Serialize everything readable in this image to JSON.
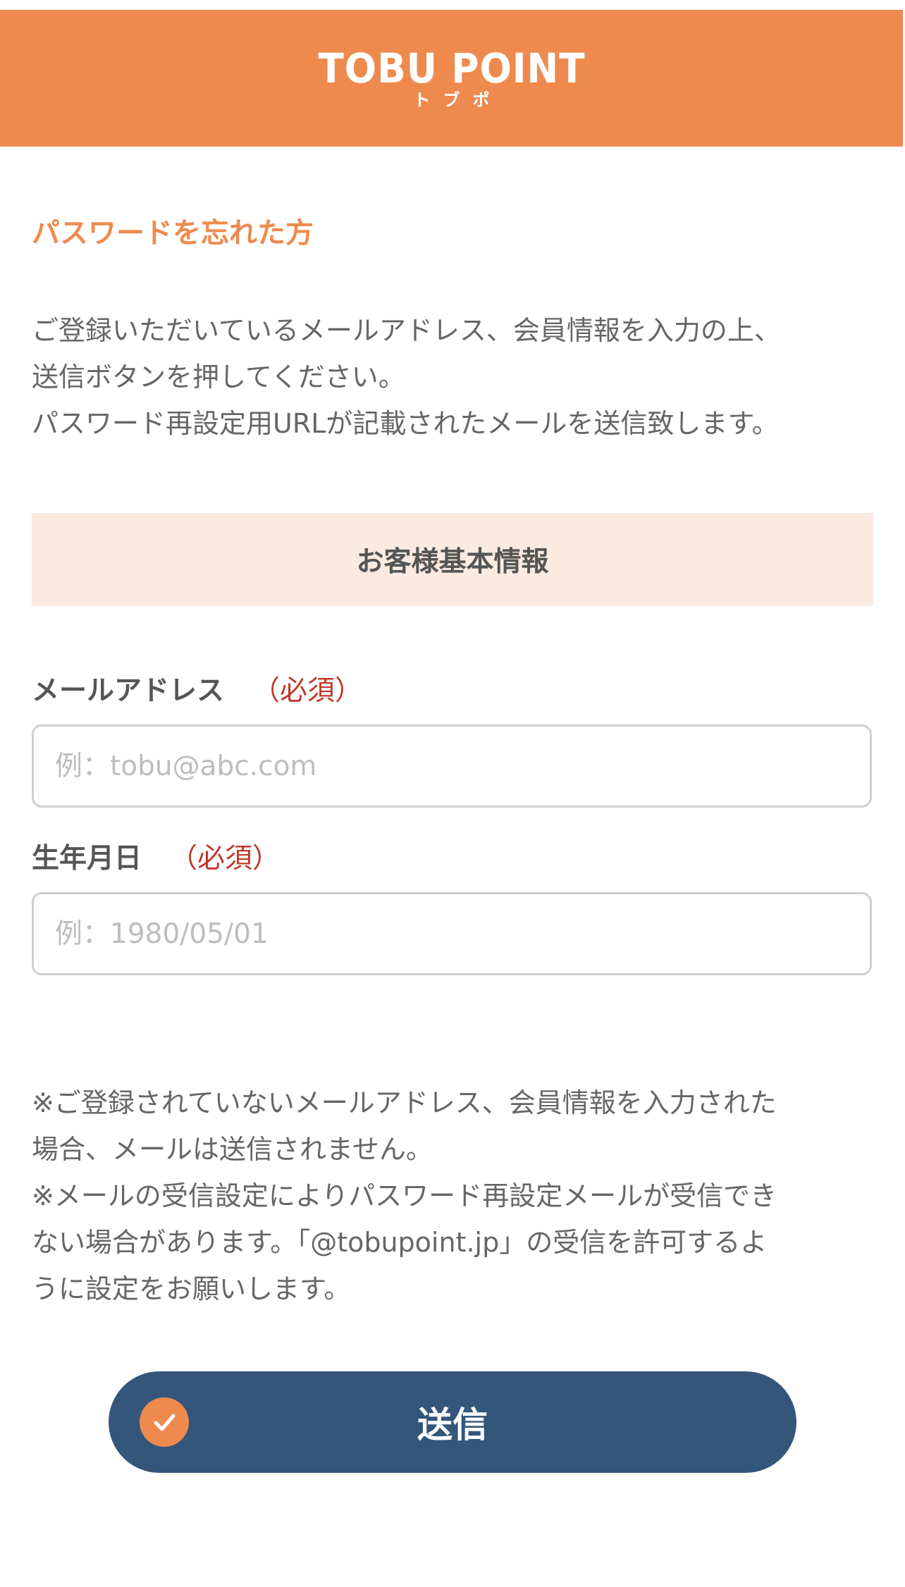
{
  "header": {
    "logo_main": "TOBU POINT",
    "logo_sub": "トブポ",
    "background_color": "#ee8a4e"
  },
  "page": {
    "title": "パスワードを忘れた方",
    "intro_lines": [
      "ご登録いただいているメールアドレス、会員情報を入力の上、",
      "送信ボタンを押してください。",
      "パスワード再設定用URLが記載されたメールを送信致します。"
    ]
  },
  "section": {
    "title": "お客様基本情報"
  },
  "form": {
    "email": {
      "label": "メールアドレス",
      "required": "（必須）",
      "value": "",
      "placeholder": "例：tobu@abc.com"
    },
    "birthdate": {
      "label": "生年月日",
      "required": "（必須）",
      "value": "",
      "placeholder": "例：1980/05/01"
    }
  },
  "notes": {
    "lines": [
      "※ご登録されていないメールアドレス、会員情報を入力された",
      "場合、メールは送信されません。",
      "※メールの受信設定によりパスワード再設定メールが受信でき",
      "ない場合があります。「@tobupoint.jp」の受信を許可するよ",
      "うに設定をお願いします。"
    ]
  },
  "submit": {
    "label": "送信",
    "icon": "check-icon",
    "background_color": "#34567b",
    "icon_color": "#ee8a4e"
  }
}
